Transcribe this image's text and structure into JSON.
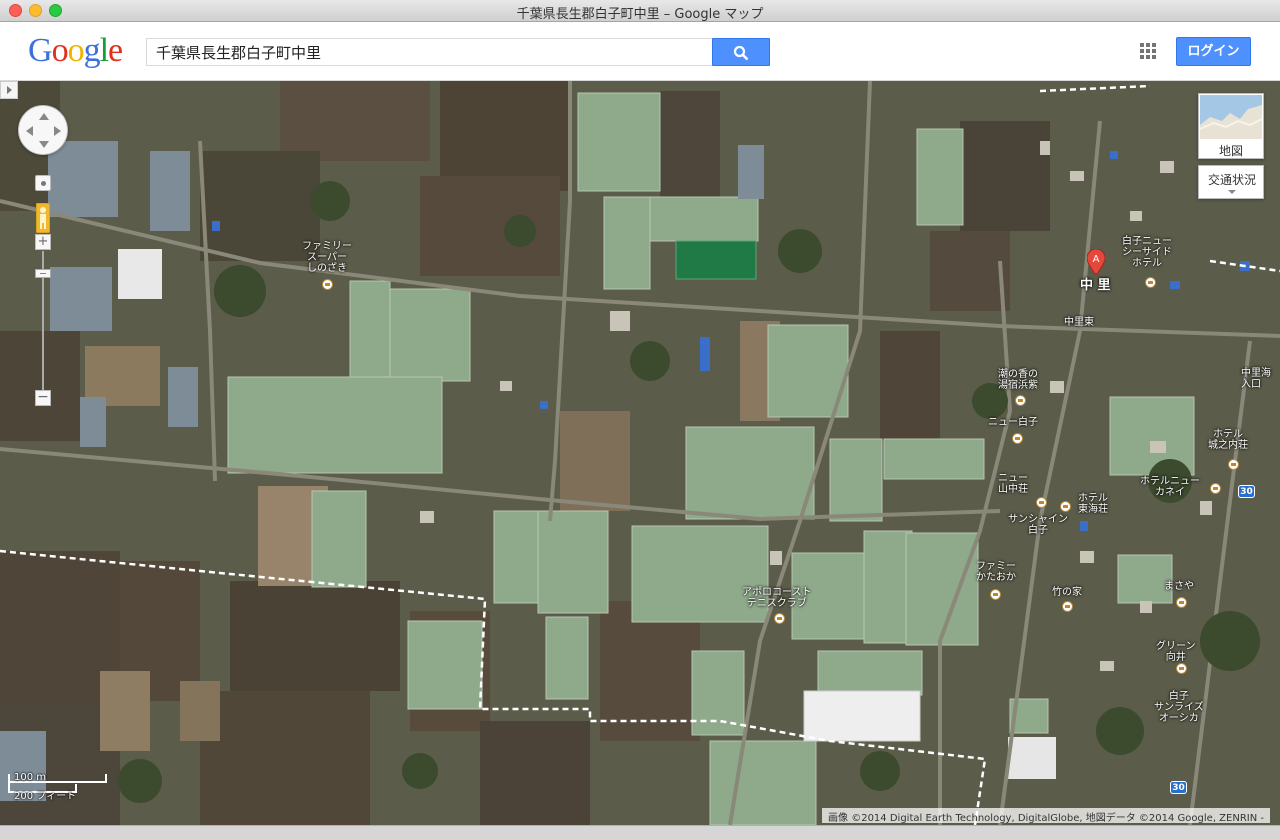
{
  "window": {
    "title": "千葉県長生郡白子町中里 – Google マップ"
  },
  "header": {
    "logo_letters": [
      "G",
      "o",
      "o",
      "g",
      "l",
      "e"
    ],
    "search_value": "千葉県長生郡白子町中里",
    "search_icon": "search-icon",
    "apps_icon": "apps-grid-icon",
    "login_label": "ログイン"
  },
  "map": {
    "imagery_type": "satellite",
    "marker": {
      "letter": "A",
      "label": "中 里"
    },
    "layer_card_label": "地図",
    "traffic_label": "交通状況",
    "scale": {
      "metric": "100 m",
      "imperial": "200 フィート"
    },
    "copyright": "画像 ©2014 Digital Earth Technology, DigitalGlobe, 地図データ ©2014 Google, ZENRIN -",
    "labels": [
      {
        "id": "family-super",
        "text": "ファミリー\nスーパー\nしのざき"
      },
      {
        "id": "shirako-new-seaside",
        "text": "白子ニュー\nシーサイド\nホテル"
      },
      {
        "id": "nakazato-higashi",
        "text": "中里東"
      },
      {
        "id": "shionoka",
        "text": "潮の香の\n湯宿浜紫"
      },
      {
        "id": "new-shirako",
        "text": "ニュー白子"
      },
      {
        "id": "new-sanchuso",
        "text": "ニュー\n山中荘"
      },
      {
        "id": "hotel-shiro-uchi",
        "text": "ホテル\n城之内荘"
      },
      {
        "id": "hotel-new-kanei",
        "text": "ホテルニュー\nカネイ"
      },
      {
        "id": "hotel-tokaiso",
        "text": "ホテル\n東海荘"
      },
      {
        "id": "sunshine-shirako",
        "text": "サンシャイン\n白子"
      },
      {
        "id": "family-kataoka",
        "text": "ファミー\nかたおか"
      },
      {
        "id": "takenoie",
        "text": "竹の家"
      },
      {
        "id": "masaya",
        "text": "まさや"
      },
      {
        "id": "apollo-coast",
        "text": "アポロコースト\nテニスクラブ"
      },
      {
        "id": "green-mukai",
        "text": "グリーン\n向井"
      },
      {
        "id": "shirako-sunrise",
        "text": "白子\nサンライズ\nオーシカ"
      },
      {
        "id": "nakazato-kaigan",
        "text": "中里海\n入口"
      }
    ],
    "route_numbers": [
      "30",
      "30"
    ]
  }
}
